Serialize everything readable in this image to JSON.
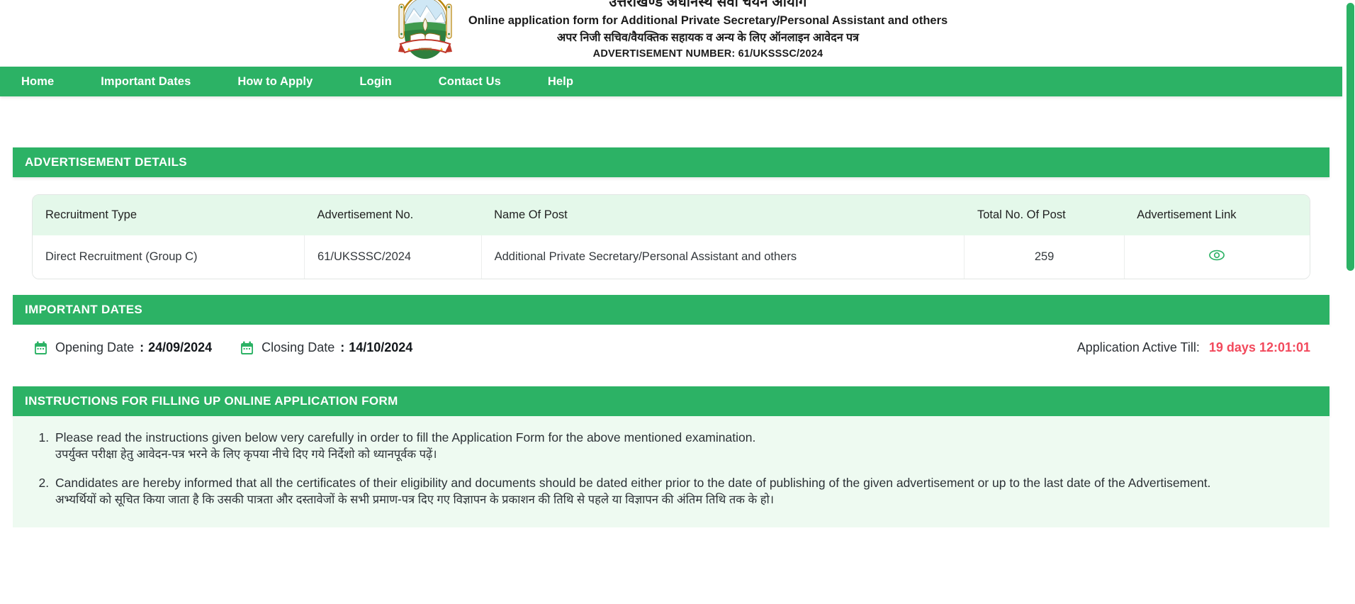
{
  "masthead": {
    "org_title_hi": "उत्तराखण्ड अधीनस्थ सेवा चयन आयोग",
    "subtitle_en": "Online application form for Additional Private Secretary/Personal Assistant and others",
    "subtitle_hi": "अपर निजी सचिव/वैयक्तिक सहायक व अन्य के लिए ऑनलाइन आवेदन पत्र",
    "advertisement_number": "ADVERTISEMENT NUMBER: 61/UKSSSC/2024",
    "emblem_icon": "uttarakhand-state-emblem"
  },
  "nav": {
    "items": [
      {
        "label": "Home"
      },
      {
        "label": "Important Dates"
      },
      {
        "label": "How to Apply"
      },
      {
        "label": "Login"
      },
      {
        "label": "Contact Us"
      },
      {
        "label": "Help"
      }
    ]
  },
  "advertisement_details": {
    "section_title": "ADVERTISEMENT DETAILS",
    "columns": [
      "Recruitment Type",
      "Advertisement No.",
      "Name Of Post",
      "Total No. Of Post",
      "Advertisement Link"
    ],
    "rows": [
      {
        "recruitment_type": "Direct Recruitment (Group C)",
        "advertisement_no": "61/UKSSSC/2024",
        "name_of_post": "Additional Private Secretary/Personal Assistant and others",
        "total_no_of_post": "259",
        "link_icon": "eye-icon"
      }
    ]
  },
  "important_dates": {
    "section_title": "IMPORTANT DATES",
    "opening_label": "Opening Date",
    "opening_separator": ":",
    "opening_value": "24/09/2024",
    "closing_label": "Closing Date",
    "closing_separator": ":",
    "closing_value": "14/10/2024",
    "active_till_label": "Application Active Till:",
    "active_till_value": "19 days 12:01:01",
    "calendar_icon": "calendar-icon"
  },
  "instructions": {
    "section_title": "INSTRUCTIONS FOR FILLING UP ONLINE APPLICATION FORM",
    "items": [
      {
        "en": "Please read the instructions given below very carefully in order to fill the Application Form for the above mentioned examination.",
        "hi": "उपर्युक्त परीक्षा हेतु आवेदन-पत्र भरने के लिए कृपया नीचे दिए गये निर्देशो को ध्यानपूर्वक पढ़ें।"
      },
      {
        "en": "Candidates are hereby informed that all the certificates of their eligibility and documents should be dated either prior to the date of publishing of the given advertisement or up to the last date of the Advertisement.",
        "hi": "अभ्यर्थियों को सूचित किया जाता है कि उसकी पात्रता और दस्तावेजों के सभी प्रमाण-पत्र दिए गए विज्ञापन के प्रकाशन की तिथि से पहले या विज्ञापन की अंतिम तिथि तक के हो।"
      }
    ]
  },
  "theme": {
    "brand_green": "#2CB265",
    "header_row_bg": "#E4F8EA",
    "instructions_bg": "#EEFAF1",
    "timer_red": "#F2495C"
  }
}
